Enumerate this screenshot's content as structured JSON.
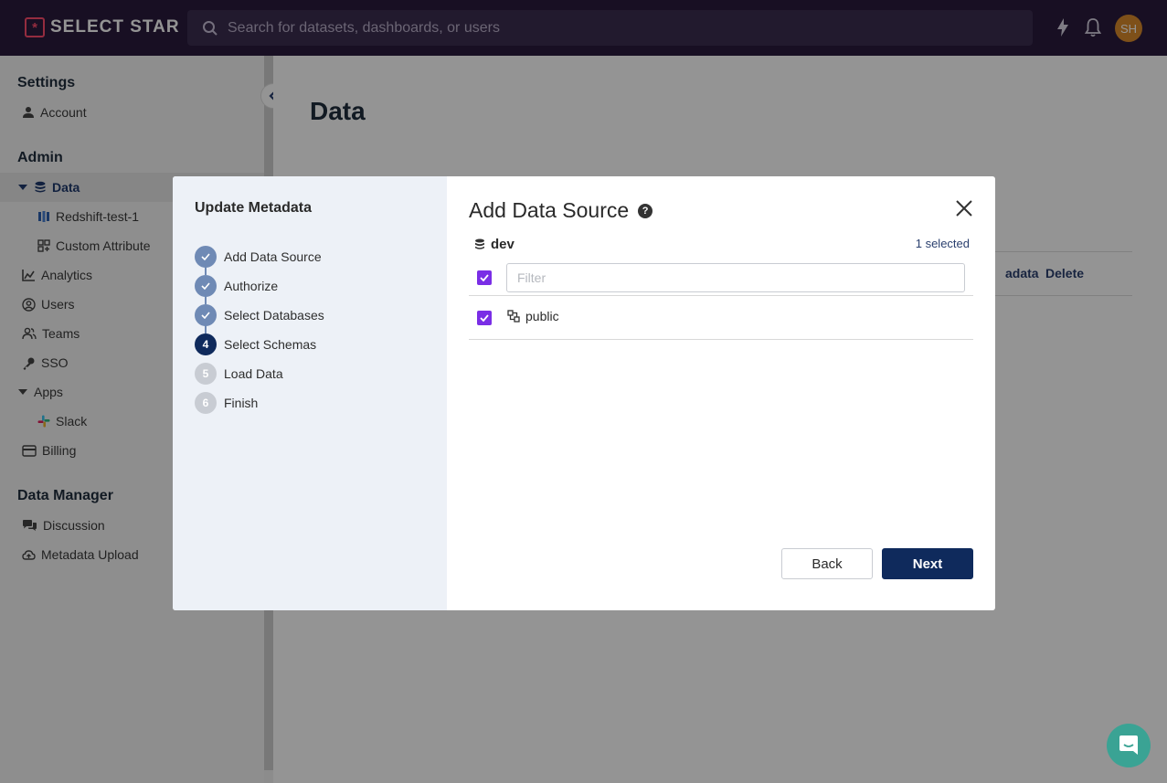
{
  "app": {
    "logo_text": "SELECT STAR",
    "logo_mark": "*",
    "search_placeholder": "Search for datasets, dashboards, or users",
    "avatar_initials": "SH",
    "accent_color": "#0f2a5c",
    "brand_color": "#ff4d6d"
  },
  "sidebar": {
    "settings_title": "Settings",
    "account": "Account",
    "admin_title": "Admin",
    "data": "Data",
    "redshift": "Redshift-test-1",
    "custom_attribute": "Custom Attribute",
    "analytics": "Analytics",
    "users": "Users",
    "teams": "Teams",
    "sso": "SSO",
    "apps": "Apps",
    "slack": "Slack",
    "billing": "Billing",
    "data_manager_title": "Data Manager",
    "discussion": "Discussion",
    "metadata_upload": "Metadata Upload"
  },
  "main": {
    "title": "Data",
    "table_link_metadata": "adata",
    "table_link_delete": "Delete"
  },
  "modal": {
    "left_title": "Update Metadata",
    "steps": [
      {
        "num": "1",
        "label": "Add Data Source",
        "state": "done"
      },
      {
        "num": "2",
        "label": "Authorize",
        "state": "done"
      },
      {
        "num": "3",
        "label": "Select Databases",
        "state": "done"
      },
      {
        "num": "4",
        "label": "Select Schemas",
        "state": "current"
      },
      {
        "num": "5",
        "label": "Load Data",
        "state": "todo"
      },
      {
        "num": "6",
        "label": "Finish",
        "state": "todo"
      }
    ],
    "title": "Add Data Source",
    "help_icon": "?",
    "database": "dev",
    "selected_count": "1 selected",
    "filter_placeholder": "Filter",
    "schemas": [
      {
        "name": "public",
        "checked": true
      }
    ],
    "back_label": "Back",
    "next_label": "Next"
  }
}
